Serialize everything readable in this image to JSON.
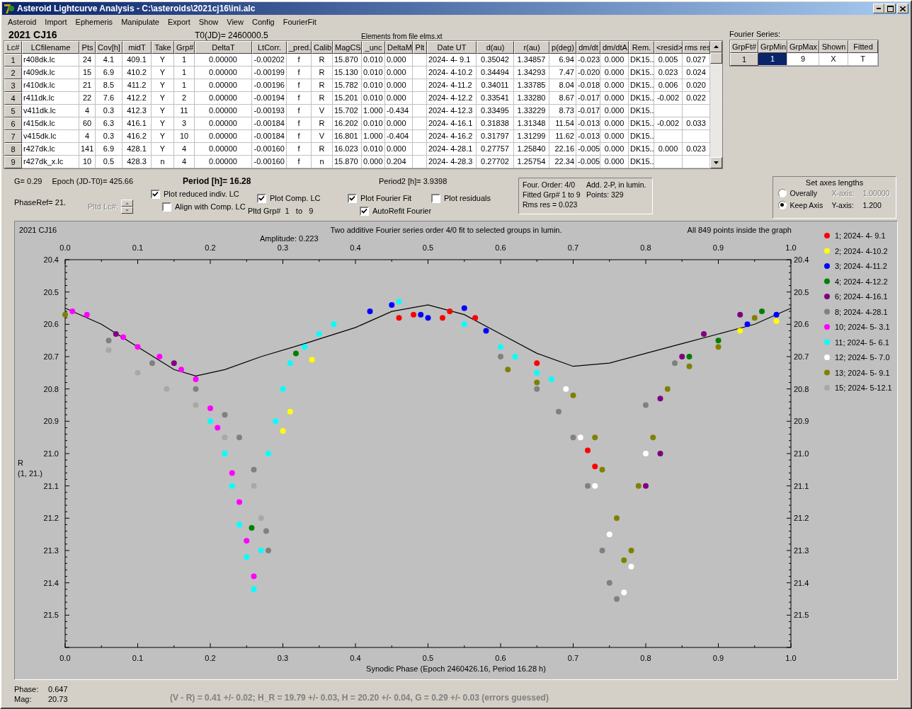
{
  "window": {
    "title": "Asteroid Lightcurve Analysis - C:\\asteroids\\2021cj16\\ini.alc"
  },
  "menu": [
    "Asteroid",
    "Import",
    "Ephemeris",
    "Manipulate",
    "Export",
    "Show",
    "View",
    "Config",
    "FourierFit"
  ],
  "asteroid_name": "2021 CJ16",
  "t0": "T0(JD)= 2460000.5",
  "elements_source": "Elements from file elms.xt",
  "table": {
    "columns": [
      "Lc#",
      "LCfilename",
      "Pts",
      "Cov[h]",
      "midT",
      "Take",
      "Grp#",
      "DeltaT",
      "LtCorr.",
      "_pred.",
      "Calib.",
      "MagCS",
      "_unc",
      "DeltaM",
      "Plt",
      "Date UT",
      "d(au)",
      "r(au)",
      "p(deg)",
      "dm/dt",
      "dm/dtA",
      "Rem.",
      "<resid>",
      "rms res"
    ],
    "rows": [
      {
        "cells": [
          "1",
          "r408dk.lc",
          "24",
          "4.1",
          "409.1",
          "Y",
          "1",
          "0.00000",
          "-0.00202",
          "f",
          "R",
          "15.870",
          "0.010",
          "0.000",
          null,
          "2024- 4- 9.1",
          "0.35042",
          "1.34857",
          "6.94",
          "-0.023",
          "0.000",
          "DK15..",
          "0.005",
          "0.027"
        ]
      },
      {
        "cells": [
          "2",
          "r409dk.lc",
          "15",
          "6.9",
          "410.2",
          "Y",
          "1",
          "0.00000",
          "-0.00199",
          "f",
          "R",
          "15.130",
          "0.010",
          "0.000",
          null,
          "2024- 4-10.2",
          "0.34494",
          "1.34293",
          "7.47",
          "-0.020",
          "0.000",
          "DK15..",
          "0.023",
          "0.024"
        ]
      },
      {
        "cells": [
          "3",
          "r410dk.lc",
          "21",
          "8.5",
          "411.2",
          "Y",
          "1",
          "0.00000",
          "-0.00196",
          "f",
          "R",
          "15.782",
          "0.010",
          "0.000",
          null,
          "2024- 4-11.2",
          "0.34011",
          "1.33785",
          "8.04",
          "-0.018",
          "0.000",
          "DK15..",
          "0.006",
          "0.020"
        ]
      },
      {
        "cells": [
          "4",
          "r411dk.lc",
          "22",
          "7.6",
          "412.2",
          "Y",
          "2",
          "0.00000",
          "-0.00194",
          "f",
          "R",
          "15.201",
          "0.010",
          "0.000",
          null,
          "2024- 4-12.2",
          "0.33541",
          "1.33280",
          "8.67",
          "-0.017",
          "0.000",
          "DK15..",
          "-0.002",
          "0.022"
        ]
      },
      {
        "cells": [
          "5",
          "v411dk.lc",
          "4",
          "0.3",
          "412.3",
          "Y",
          "11",
          "0.00000",
          "-0.00193",
          "f",
          "V",
          "15.702",
          "1.000",
          "-0.434",
          null,
          "2024- 4-12.3",
          "0.33495",
          "1.33229",
          "8.73",
          "-0.017",
          "0.000",
          "DK15..",
          null,
          null
        ]
      },
      {
        "cells": [
          "6",
          "r415dk.lc",
          "60",
          "6.3",
          "416.1",
          "Y",
          "3",
          "0.00000",
          "-0.00184",
          "f",
          "R",
          "16.202",
          "0.010",
          "0.000",
          null,
          "2024- 4-16.1",
          "0.31838",
          "1.31348",
          "11.54",
          "-0.013",
          "0.000",
          "DK15..",
          "-0.002",
          "0.033"
        ]
      },
      {
        "cells": [
          "7",
          "v415dk.lc",
          "4",
          "0.3",
          "416.2",
          "Y",
          "10",
          "0.00000",
          "-0.00184",
          "f",
          "V",
          "16.801",
          "1.000",
          "-0.404",
          null,
          "2024- 4-16.2",
          "0.31797",
          "1.31299",
          "11.62",
          "-0.013",
          "0.000",
          "DK15..",
          null,
          null
        ]
      },
      {
        "cells": [
          "8",
          "r427dk.lc",
          "141",
          "6.9",
          "428.1",
          "Y",
          "4",
          "0.00000",
          "-0.00160",
          "f",
          "R",
          "16.023",
          "0.010",
          "0.000",
          null,
          "2024- 4-28.1",
          "0.27757",
          "1.25840",
          "22.16",
          "-0.005",
          "0.000",
          "DK15..",
          "0.000",
          "0.023"
        ]
      },
      {
        "cells": [
          "9",
          "r427dk_x.lc",
          "10",
          "0.5",
          "428.3",
          "n",
          "4",
          "0.00000",
          "-0.00160",
          "f",
          "n",
          "15.870",
          "0.000",
          "0.204",
          null,
          "2024- 4-28.3",
          "0.27702",
          "1.25754",
          "22.34",
          "-0.005",
          "0.000",
          "DK15..",
          null,
          null
        ]
      }
    ]
  },
  "fourier_series": {
    "label": "Fourier Series:",
    "columns": [
      "GrpFt#",
      "GrpMin",
      "GrpMax",
      "Shown",
      "Fitted"
    ],
    "rows": [
      {
        "cells": [
          {
            "text": "1",
            "selected": false
          },
          {
            "text": "1",
            "selected": true
          },
          {
            "text": "9",
            "selected": false
          },
          {
            "text": "X",
            "selected": false
          },
          {
            "text": "T",
            "selected": false
          }
        ]
      }
    ]
  },
  "info": {
    "g": "G= 0.29",
    "epoch": "Epoch (JD-T0)= 425.66",
    "period": "Period [h]= 16.28",
    "period2": "Period2 [h]= 3.9398",
    "phase_ref": "PhaseRef= 21.",
    "pltd_lc": {
      "label": "Pltd Lc#:",
      "disabled": true
    },
    "pltd_grp": "Pltd Grp#  1   to   9"
  },
  "checkboxes": [
    {
      "label": "Plot reduced indiv. LC",
      "checked": true
    },
    {
      "label": "Align with Comp. LC",
      "checked": false
    },
    {
      "label": "Plot Comp. LC",
      "checked": true
    },
    {
      "label": "Plot Fourier Fit",
      "checked": true
    },
    {
      "label": "AutoRefit Fourier",
      "checked": true
    },
    {
      "label": "Plot residuals",
      "checked": false
    }
  ],
  "fit_summary": [
    {
      "left": "Four. Order:  4/0",
      "right": "Add. 2-P, in lumin."
    },
    {
      "left": "Fitted Grp# 1 to 9",
      "right": "Points: 329"
    },
    {
      "left": "Rms res     = 0.023"
    }
  ],
  "axes_lengths": {
    "title": "Set axes lengths",
    "options": [
      {
        "label": "Overally",
        "selected": false,
        "axis": "X-axis:",
        "value": "1.00000",
        "disabled": true
      },
      {
        "label": "Keep Axis",
        "selected": true,
        "axis": "Y-axis:",
        "value": "1.200",
        "disabled": false
      }
    ]
  },
  "chart": {
    "object": "2021 CJ16",
    "subtitle": "Amplitude: 0.223",
    "points_note": "All 849 points inside the graph",
    "ylabel_sub": "(1, 21.)",
    "top_ticks": [
      "0.0",
      "0.1",
      "0.2",
      "0.3",
      "0.4",
      "0.5",
      "0.6",
      "0.7",
      "0.8",
      "0.9",
      "1.0"
    ],
    "right_ticks": [
      "20.4",
      "20.5",
      "20.6",
      "20.7",
      "20.8",
      "20.9",
      "21.0",
      "21.1",
      "21.2",
      "21.3",
      "21.4",
      "21.5"
    ],
    "chart_data": {
      "type": "scatter",
      "title": "Two additive Fourier series order 4/0 fit to selected groups in lumin.",
      "xlabel": "Synodic Phase (Epoch 2460426.16, Period 16.28 h)",
      "ylabel": "R",
      "legend": "right",
      "xlim": [
        0,
        1
      ],
      "ylim": [
        21.6,
        20.4
      ],
      "xticks": [
        {
          "value": 0,
          "label": "0.0"
        },
        0.1,
        0.2,
        0.3,
        0.4,
        0.5,
        0.6,
        0.7,
        0.8,
        0.9,
        {
          "value": 1,
          "label": "1.0"
        }
      ],
      "yticks": [
        20.4,
        20.5,
        20.6,
        20.7,
        20.8,
        20.9,
        {
          "value": 21,
          "label": "21.0"
        },
        21.1,
        21.2,
        21.3,
        21.4,
        21.5
      ],
      "series": [
        {
          "name": "1; 2024- 4- 9.1",
          "color": "#ff0000",
          "x": [
            0.46,
            0.48,
            0.52,
            0.53,
            0.565,
            0.65,
            0.72,
            0.73
          ],
          "values": [
            20.58,
            20.57,
            20.58,
            20.56,
            20.58,
            20.72,
            20.99,
            21.04
          ]
        },
        {
          "name": "2; 2024- 4-10.2",
          "color": "#ffff00",
          "x": [
            0.3,
            0.31,
            0.34,
            0.93,
            0.98
          ],
          "values": [
            20.93,
            20.87,
            20.71,
            20.62,
            20.59
          ]
        },
        {
          "name": "3; 2024- 4-11.2",
          "color": "#0000ff",
          "x": [
            0.42,
            0.45,
            0.5,
            0.49,
            0.55,
            0.58,
            0.94,
            0.98
          ],
          "values": [
            20.56,
            20.54,
            20.58,
            20.57,
            20.55,
            20.62,
            20.6,
            20.57
          ]
        },
        {
          "name": "4; 2024- 4-12.2",
          "color": "#008000",
          "x": [
            0.318,
            0.257,
            0.86,
            0.9,
            0.96
          ],
          "values": [
            20.69,
            21.23,
            20.7,
            20.65,
            20.56
          ]
        },
        {
          "name": "6; 2024- 4-16.1",
          "color": "#800080",
          "x": [
            0.07,
            0.15,
            0.82,
            0.85,
            0.88,
            0.93,
            0.82,
            0.8
          ],
          "values": [
            20.63,
            20.72,
            20.83,
            20.7,
            20.63,
            20.57,
            21.0,
            21.1
          ]
        },
        {
          "name": "8; 2024- 4-28.1",
          "color": "#808080",
          "x": [
            0.06,
            0.12,
            0.18,
            0.22,
            0.24,
            0.26,
            0.277,
            0.28,
            0.6,
            0.65,
            0.68,
            0.7,
            0.72,
            0.74,
            0.75,
            0.76,
            0.8,
            0.84
          ],
          "values": [
            20.65,
            20.72,
            20.8,
            20.88,
            20.95,
            21.05,
            21.24,
            21.3,
            20.7,
            20.8,
            20.87,
            20.95,
            21.1,
            21.3,
            21.4,
            21.45,
            20.85,
            20.72
          ]
        },
        {
          "name": "10; 2024- 5- 3.1",
          "color": "#ff00ff",
          "x": [
            0.01,
            0.03,
            0.08,
            0.1,
            0.13,
            0.16,
            0.18,
            0.2,
            0.21,
            0.23,
            0.24,
            0.25,
            0.26
          ],
          "values": [
            20.56,
            20.57,
            20.64,
            20.67,
            20.7,
            20.74,
            20.77,
            20.86,
            20.92,
            21.06,
            21.15,
            21.27,
            21.38
          ]
        },
        {
          "name": "11; 2024- 5- 6.1",
          "color": "#00ffff",
          "x": [
            0.2,
            0.22,
            0.23,
            0.24,
            0.25,
            0.26,
            0.27,
            0.28,
            0.29,
            0.3,
            0.31,
            0.33,
            0.35,
            0.37,
            0.46,
            0.55,
            0.6,
            0.62,
            0.65,
            0.67
          ],
          "values": [
            20.9,
            21.0,
            21.1,
            21.22,
            21.32,
            21.42,
            21.3,
            21.0,
            20.9,
            20.8,
            20.72,
            20.67,
            20.63,
            20.6,
            20.53,
            20.6,
            20.67,
            20.7,
            20.75,
            20.77
          ]
        },
        {
          "name": "12; 2024- 5- 7.0",
          "color": "#ffffff",
          "x": [
            0.69,
            0.71,
            0.73,
            0.75,
            0.77,
            0.78,
            0.8
          ],
          "values": [
            20.8,
            20.95,
            21.1,
            21.25,
            21.43,
            21.35,
            21.0
          ]
        },
        {
          "name": "13; 2024- 5- 9.1",
          "color": "#808000",
          "x": [
            0.0,
            0.61,
            0.65,
            0.7,
            0.73,
            0.74,
            0.76,
            0.77,
            0.78,
            0.79,
            0.81,
            0.83,
            0.86,
            0.9,
            0.95
          ],
          "values": [
            20.57,
            20.74,
            20.78,
            20.82,
            20.95,
            21.05,
            21.2,
            21.33,
            21.3,
            21.1,
            20.95,
            20.8,
            20.73,
            20.67,
            20.58
          ]
        },
        {
          "name": "15; 2024- 5-12.1",
          "color": "#a8a8a8",
          "x": [
            0.06,
            0.1,
            0.14,
            0.18,
            0.22,
            0.26,
            0.27
          ],
          "values": [
            20.68,
            20.75,
            20.8,
            20.85,
            20.95,
            21.1,
            21.2
          ]
        },
        {
          "type": "line",
          "color": "#000000",
          "x": [
            0,
            0.05,
            0.1,
            0.15,
            0.18,
            0.22,
            0.27,
            0.33,
            0.4,
            0.45,
            0.5,
            0.55,
            0.6,
            0.65,
            0.7,
            0.75,
            0.8,
            0.85,
            0.9,
            0.95,
            1.0
          ],
          "values": [
            20.55,
            20.6,
            20.67,
            20.74,
            20.76,
            20.74,
            20.7,
            20.66,
            20.61,
            20.56,
            20.54,
            20.57,
            20.63,
            20.69,
            20.73,
            20.72,
            20.69,
            20.66,
            20.63,
            20.6,
            20.55
          ]
        }
      ]
    }
  },
  "footer": {
    "phase_label": "Phase:",
    "phase": "0.647",
    "mag_label": "Mag:",
    "mag": "20.73",
    "status": "(V - R) = 0.41 +/- 0.02; H_R = 19.79 +/- 0.03, H = 20.20 +/- 0.04, G = 0.29 +/- 0.03 (errors guessed)"
  }
}
